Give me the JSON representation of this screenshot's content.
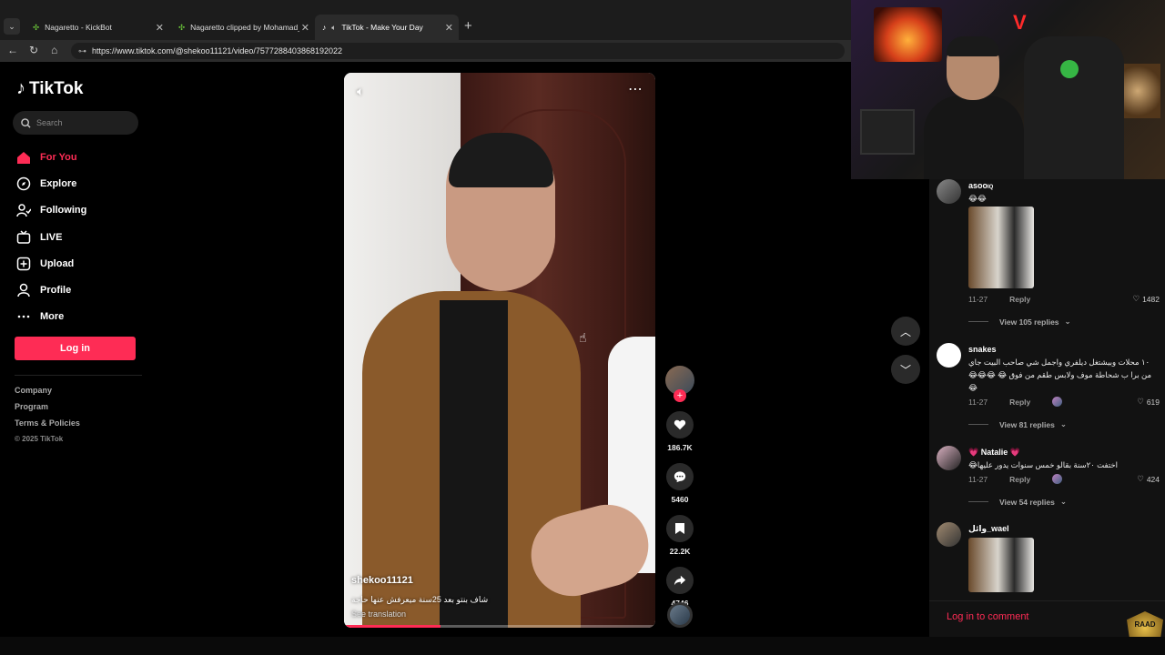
{
  "browser": {
    "tabs": [
      {
        "title": "Nagaretto - KickBot",
        "active": false
      },
      {
        "title": "Nagaretto clipped by Mohamad_S",
        "active": false
      },
      {
        "title": "TikTok - Make Your Day",
        "active": true
      }
    ],
    "url": "https://www.tiktok.com/@shekoo11121/video/7577288403868192022"
  },
  "sidebar": {
    "logo": "TikTok",
    "search_placeholder": "Search",
    "nav": [
      {
        "label": "For You",
        "icon": "home-icon",
        "active": true
      },
      {
        "label": "Explore",
        "icon": "compass-icon",
        "active": false
      },
      {
        "label": "Following",
        "icon": "following-icon",
        "active": false
      },
      {
        "label": "LIVE",
        "icon": "live-icon",
        "active": false
      },
      {
        "label": "Upload",
        "icon": "upload-icon",
        "active": false
      },
      {
        "label": "Profile",
        "icon": "profile-icon",
        "active": false
      },
      {
        "label": "More",
        "icon": "more-icon",
        "active": false
      }
    ],
    "login": "Log in",
    "footer": [
      "Company",
      "Program",
      "Terms & Policies"
    ],
    "copyright": "© 2025 TikTok"
  },
  "video": {
    "username": "shekoo11121",
    "description": "شاف بنتو بعد 25سنة ميعرفش عنها حاجة",
    "translate": "See translation",
    "progress": 0.31
  },
  "actions": {
    "likes": "186.7K",
    "comments": "5460",
    "saves": "22.2K",
    "shares": "4746"
  },
  "comments": [
    {
      "name": "asoo",
      "badge": "IQ",
      "text": "😂😂",
      "date": "11-27",
      "reply": "Reply",
      "likes": "1482",
      "replies": "View 105 replies"
    },
    {
      "name": "snakes",
      "text": "١٠ محلات وبيشتغل ديلفري واجمل شي صاحب البيت جاي من برا ب شحاطة موف ولابس طقم من فوق 😂 😂😂😂😂",
      "date": "11-27",
      "reply": "Reply",
      "likes": "619",
      "replies": "View 81 replies"
    },
    {
      "name": "💗 Natalie 💗",
      "text": "اختفت ٢٠سنة بقالو خمس سنوات يدور عليها😂",
      "date": "11-27",
      "reply": "Reply",
      "likes": "424",
      "replies": "View 54 replies"
    },
    {
      "name": "وائل_wael"
    }
  ],
  "comment_login": "Log in to comment",
  "overlay_badge": "RAAD"
}
